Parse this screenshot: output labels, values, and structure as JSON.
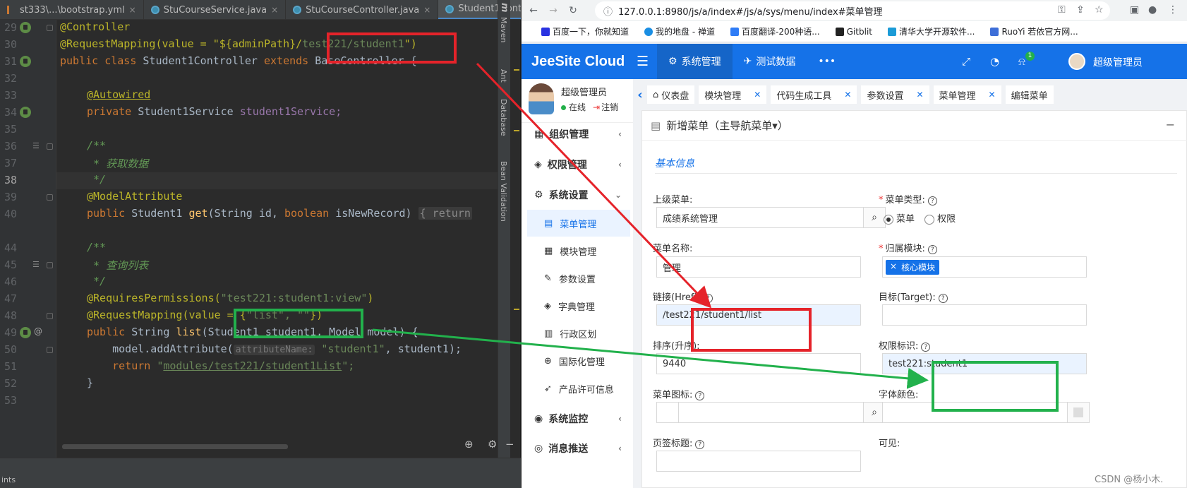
{
  "ide": {
    "tabs": [
      {
        "label": "st333\\...\\bootstrap.yml"
      },
      {
        "label": "StuCourseService.java"
      },
      {
        "label": "StuCourseController.java"
      },
      {
        "label": "Student1Controller.java"
      }
    ],
    "line_numbers": [
      "29",
      "30",
      "31",
      "32",
      "33",
      "34",
      "35",
      "36",
      "37",
      "38",
      "39",
      "40",
      "44",
      "45",
      "46",
      "47",
      "48",
      "49",
      "50",
      "51",
      "52",
      "53"
    ],
    "side_panels": [
      "Maven",
      "Ant",
      "Database",
      "Bean Validation"
    ],
    "status_text": "ints",
    "code": {
      "l29": "@Controller",
      "l30a": "@RequestMapping(value = \"${adminPath}/",
      "l30b": "test221/student1",
      "l30c": "\")",
      "l31a": "public class ",
      "l31b": "Student1Controller ",
      "l31c": "extends ",
      "l31d": "BaseController {",
      "l33": "@Autowired",
      "l34a": "private ",
      "l34b": "Student1Service ",
      "l34c": "student1Service;",
      "l36": "/**",
      "l37": " * 获取数据",
      "l38": " */",
      "l39": "@ModelAttribute",
      "l40a": "public ",
      "l40b": "Student1 ",
      "l40c": "get",
      "l40d": "(String id, ",
      "l40e": "boolean ",
      "l40f": "isNewRecord) ",
      "l40g": "{ return",
      "l44": "/**",
      "l45": " * 查询列表",
      "l46": " */",
      "l47a": "@RequiresPermissions(",
      "l47b": "\"test221:student1:view\"",
      "l47c": ")",
      "l48a": "@RequestMapping(value = {",
      "l48b": "\"list\", \"\"",
      "l48c": "})",
      "l49a": "public ",
      "l49b": "String ",
      "l49c": "list",
      "l49d": "(Student1 student1, Model model) {",
      "l50a": "    model.addAttribute(",
      "l50b": "attributeName:",
      "l50c": " \"student1\"",
      "l50d": ", student1);",
      "l51a": "    return ",
      "l51b": "\"",
      "l51c": "modules/test221/student1List",
      "l51d": "\";",
      "l52": "}"
    }
  },
  "browser": {
    "url": "127.0.0.1:8980/js/a/index#/js/a/sys/menu/index#菜单管理",
    "bookmarks": [
      {
        "label": "百度一下，你就知道"
      },
      {
        "label": "我的地盘 - 禅道"
      },
      {
        "label": "百度翻译-200种语..."
      },
      {
        "label": "Gitblit"
      },
      {
        "label": "清华大学开源软件..."
      },
      {
        "label": "RuoYi 若依官方网..."
      }
    ],
    "brand": "JeeSite Cloud",
    "top_nav": [
      {
        "label": "系统管理"
      },
      {
        "label": "测试数据"
      }
    ],
    "more": "•••",
    "notify_count": "1",
    "top_user": "超级管理员",
    "user": {
      "name": "超级管理员",
      "online": "在线",
      "logout": "注销"
    },
    "menu": {
      "org": "组织管理",
      "perm": "权限管理",
      "settings": "系统设置",
      "sub": [
        "菜单管理",
        "模块管理",
        "参数设置",
        "字典管理",
        "行政区划",
        "国际化管理",
        "产品许可信息"
      ],
      "monitor": "系统监控",
      "message": "消息推送"
    },
    "page_tabs": [
      "仪表盘",
      "模块管理",
      "代码生成工具",
      "参数设置",
      "菜单管理",
      "编辑菜单"
    ],
    "panel_title": "新增菜单（主导航菜单▾）",
    "section": "基本信息",
    "form": {
      "parent_label": "上级菜单:",
      "parent_value": "成绩系统管理",
      "type_label": "菜单类型:",
      "type_menu": "菜单",
      "type_perm": "权限",
      "name_label": "菜单名称:",
      "name_value": "管理",
      "module_label": "归属模块:",
      "module_chip": "核心模块",
      "href_label": "链接(Href):",
      "href_value": "/test221/student1/list",
      "target_label": "目标(Target):",
      "sort_label": "排序(升序):",
      "sort_value": "9440",
      "perm_label": "权限标识:",
      "perm_value": "test221:student1",
      "icon_label": "菜单图标:",
      "color_label": "字体颜色:",
      "pagetitle_label": "页签标题:",
      "visible_label": "可见:"
    },
    "watermark": "CSDN @杨小木."
  },
  "colors": {
    "accent": "#1572e8",
    "red_box": "#e5232a",
    "green_box": "#22b14c"
  }
}
